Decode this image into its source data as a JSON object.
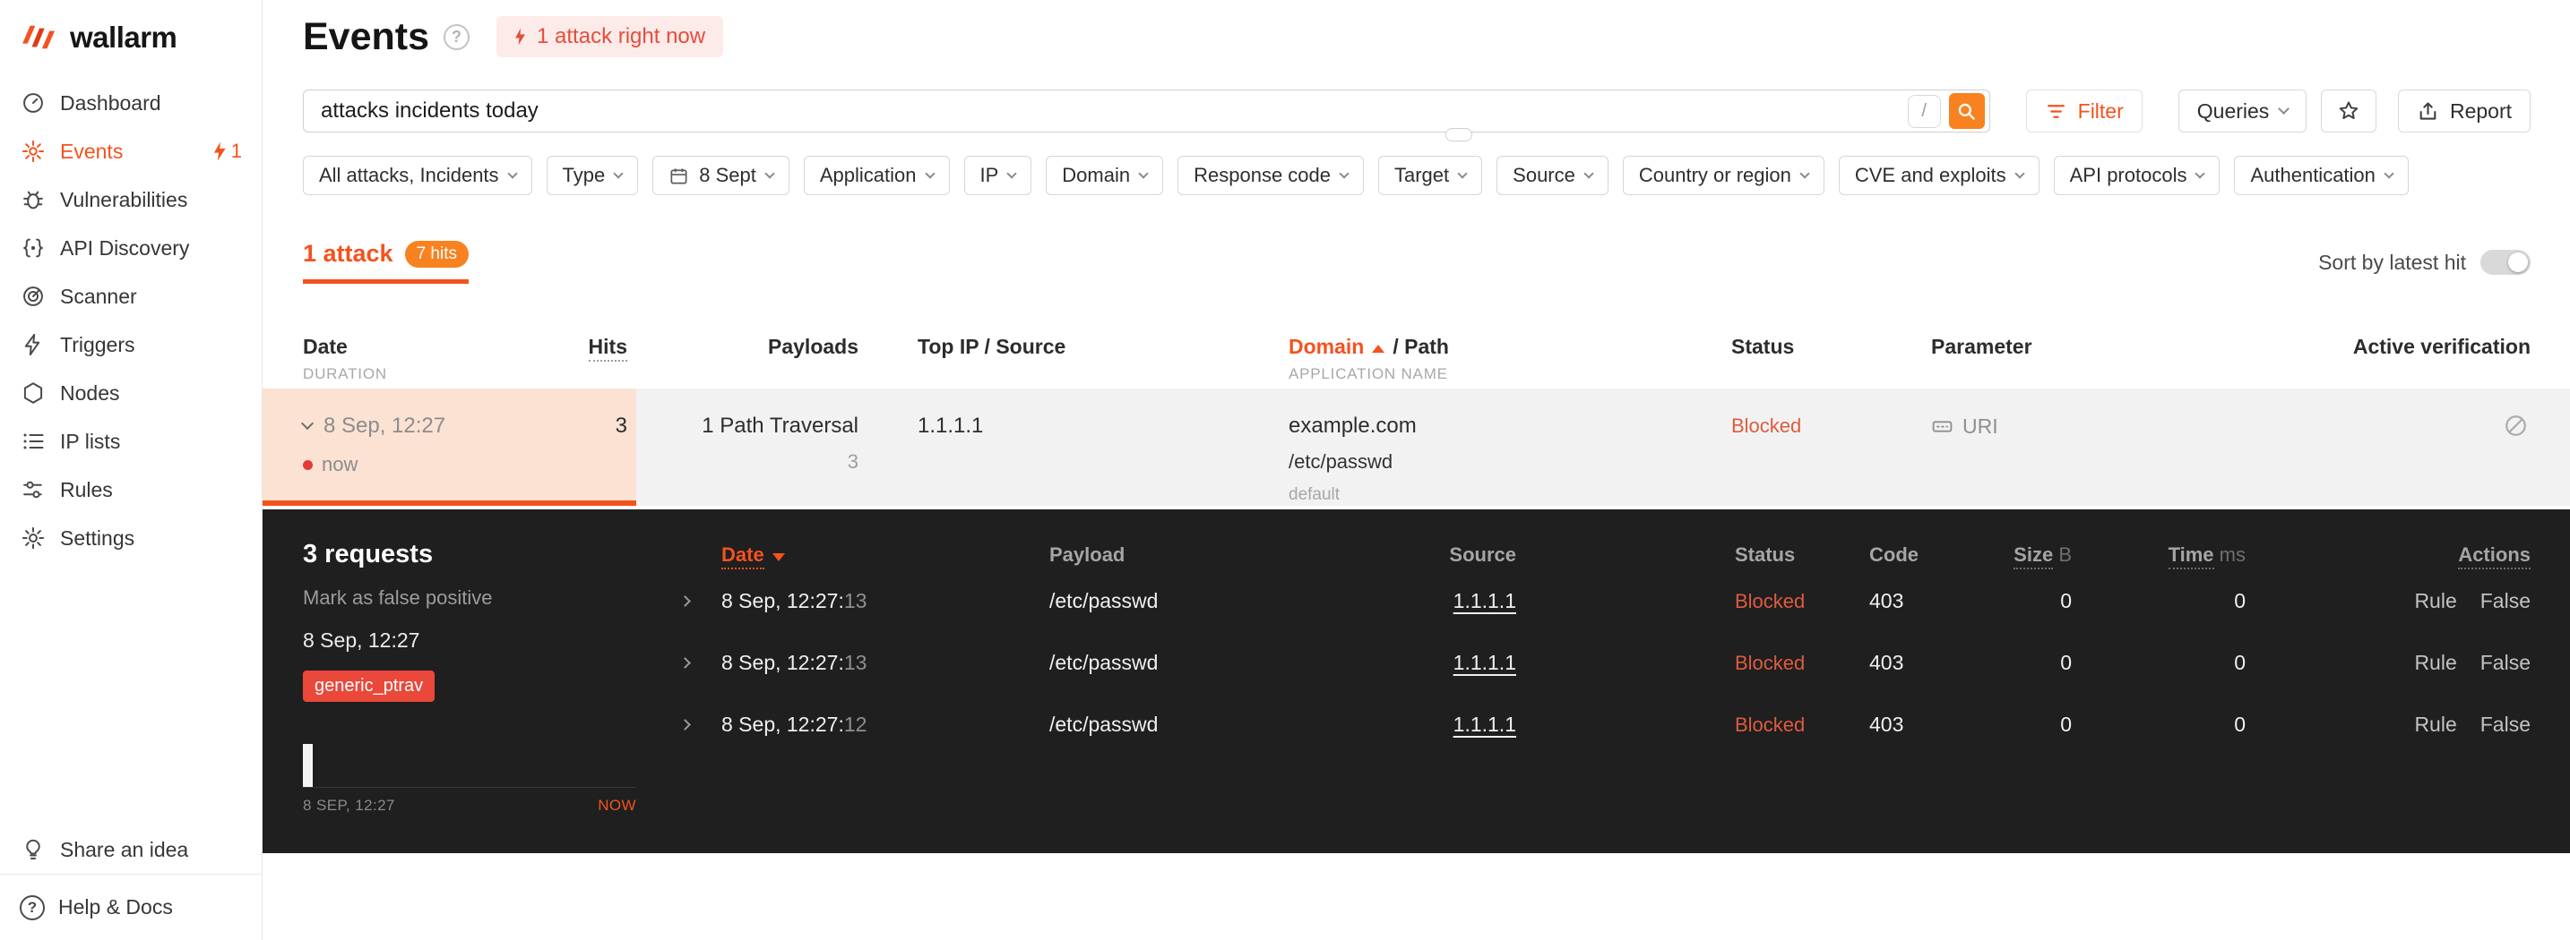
{
  "colors": {
    "accent": "#f4521e",
    "amber": "#f8821f",
    "blocked": "#df5b40",
    "alert_bg": "#fcebe9",
    "alert_text": "#e74c3c",
    "selected_row": "#fbe2d2",
    "row_bg": "#f2f2f2",
    "panel_bg": "#1f1f1f",
    "tag_bg": "#e9483b"
  },
  "sidebar": {
    "logo": "wallarm",
    "items": [
      {
        "label": "Dashboard"
      },
      {
        "label": "Events",
        "badge": "1"
      },
      {
        "label": "Vulnerabilities"
      },
      {
        "label": "API Discovery"
      },
      {
        "label": "Scanner"
      },
      {
        "label": "Triggers"
      },
      {
        "label": "Nodes"
      },
      {
        "label": "IP lists"
      },
      {
        "label": "Rules"
      },
      {
        "label": "Settings"
      }
    ],
    "share_idea": "Share an idea",
    "help_docs": "Help & Docs"
  },
  "header": {
    "title": "Events",
    "live_attack_badge": "1 attack right now"
  },
  "search": {
    "value": "attacks incidents today",
    "shortcut_key": "/",
    "filter_button": "Filter",
    "queries_button": "Queries",
    "report_button": "Report"
  },
  "filters": [
    {
      "label": "All attacks, Incidents"
    },
    {
      "label": "Type"
    },
    {
      "label": "8 Sept",
      "icon": "calendar"
    },
    {
      "label": "Application"
    },
    {
      "label": "IP"
    },
    {
      "label": "Domain"
    },
    {
      "label": "Response code"
    },
    {
      "label": "Target"
    },
    {
      "label": "Source"
    },
    {
      "label": "Country or region"
    },
    {
      "label": "CVE and exploits"
    },
    {
      "label": "API protocols"
    },
    {
      "label": "Authentication"
    }
  ],
  "results": {
    "tab_label": "1 attack",
    "hits_badge": "7 hits",
    "sort_toggle_label": "Sort by latest hit"
  },
  "attacks_table": {
    "headers": {
      "date": "Date",
      "date_sub": "DURATION",
      "hits": "Hits",
      "payloads": "Payloads",
      "top_ip": "Top IP / Source",
      "domain": "Domain",
      "domain_suffix": "/ Path",
      "domain_sub": "APPLICATION NAME",
      "status": "Status",
      "parameter": "Parameter",
      "active_verification": "Active verification"
    },
    "row": {
      "date": "8 Sep, 12:27",
      "duration": "now",
      "hits": "3",
      "payload": "1 Path Traversal",
      "payload_count": "3",
      "top_ip": "1.1.1.1",
      "domain": "example.com",
      "path": "/etc/passwd",
      "application": "default",
      "status": "Blocked",
      "parameter": "URI"
    }
  },
  "details": {
    "requests_label": "3 requests",
    "false_positive_link": "Mark as false positive",
    "date": "8 Sep, 12:27",
    "tag": "generic_ptrav",
    "timeline_start": "8 SEP, 12:27",
    "timeline_end": "NOW",
    "headers": {
      "date": "Date",
      "payload": "Payload",
      "source": "Source",
      "status": "Status",
      "code": "Code",
      "size": "Size",
      "size_unit": "B",
      "time": "Time",
      "time_unit": "ms",
      "actions": "Actions"
    },
    "rows": [
      {
        "time": "8 Sep, 12:27:",
        "seconds": "13",
        "payload": "/etc/passwd",
        "source": "1.1.1.1",
        "status": "Blocked",
        "code": "403",
        "size": "0",
        "time_ms": "0",
        "action_rule": "Rule",
        "action_false": "False"
      },
      {
        "time": "8 Sep, 12:27:",
        "seconds": "13",
        "payload": "/etc/passwd",
        "source": "1.1.1.1",
        "status": "Blocked",
        "code": "403",
        "size": "0",
        "time_ms": "0",
        "action_rule": "Rule",
        "action_false": "False"
      },
      {
        "time": "8 Sep, 12:27:",
        "seconds": "12",
        "payload": "/etc/passwd",
        "source": "1.1.1.1",
        "status": "Blocked",
        "code": "403",
        "size": "0",
        "time_ms": "0",
        "action_rule": "Rule",
        "action_false": "False"
      }
    ]
  }
}
